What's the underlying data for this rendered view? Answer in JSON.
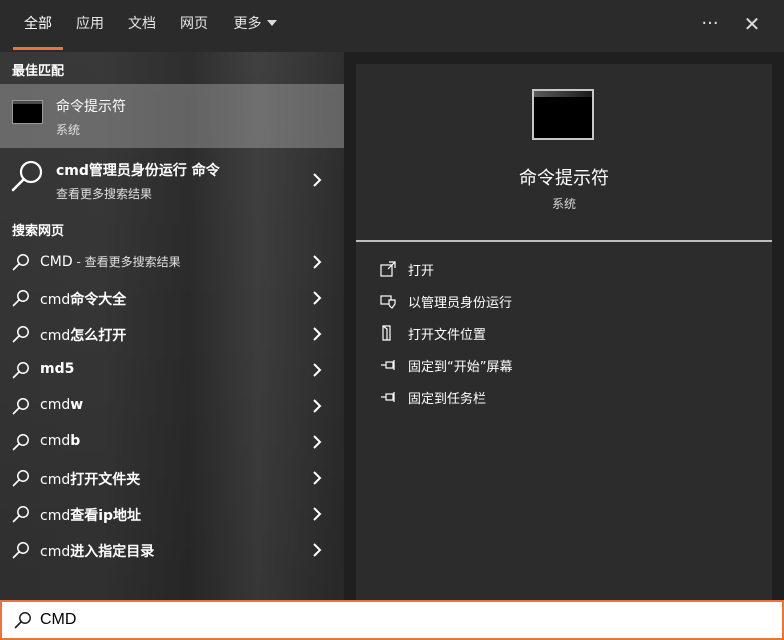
{
  "tabs": [
    {
      "label": "全部",
      "active": true
    },
    {
      "label": "应用"
    },
    {
      "label": "文档"
    },
    {
      "label": "网页"
    },
    {
      "label": "更多"
    }
  ],
  "top_icons": {
    "more": "···",
    "close": "✕"
  },
  "sections": {
    "best_match": "最佳匹配",
    "search_web": "搜索网页"
  },
  "best_match": {
    "title": "命令提示符",
    "subtitle": "系统"
  },
  "more_results_item": {
    "title": "cmd管理员身份运行 命令",
    "subtitle": "查看更多搜索结果"
  },
  "web_results": [
    {
      "prefix": "CMD",
      "bold": "",
      "hint": " - 查看更多搜索结果"
    },
    {
      "prefix": "cmd",
      "bold": "命令大全",
      "hint": ""
    },
    {
      "prefix": "cmd",
      "bold": "怎么打开",
      "hint": ""
    },
    {
      "prefix": "",
      "bold": "md5",
      "hint": ""
    },
    {
      "prefix": "cmd",
      "bold": "w",
      "hint": ""
    },
    {
      "prefix": "cmd",
      "bold": "b",
      "hint": ""
    },
    {
      "prefix": "cmd",
      "bold": "打开文件夹",
      "hint": ""
    },
    {
      "prefix": "cmd",
      "bold": "查看ip地址",
      "hint": ""
    },
    {
      "prefix": "cmd",
      "bold": "进入指定目录",
      "hint": ""
    }
  ],
  "preview": {
    "title": "命令提示符",
    "subtitle": "系统"
  },
  "actions": [
    {
      "label": "打开",
      "icon": "open-icon"
    },
    {
      "label": "以管理员身份运行",
      "icon": "admin-shield-icon"
    },
    {
      "label": "打开文件位置",
      "icon": "file-location-icon"
    },
    {
      "label": "固定到“开始”屏幕",
      "icon": "pin-icon"
    },
    {
      "label": "固定到任务栏",
      "icon": "pin-icon"
    }
  ],
  "search": {
    "value": "CMD"
  },
  "colors": {
    "accent": "#e8733b",
    "panel": "#2c2c2c",
    "selected": "#7a7a7a"
  }
}
